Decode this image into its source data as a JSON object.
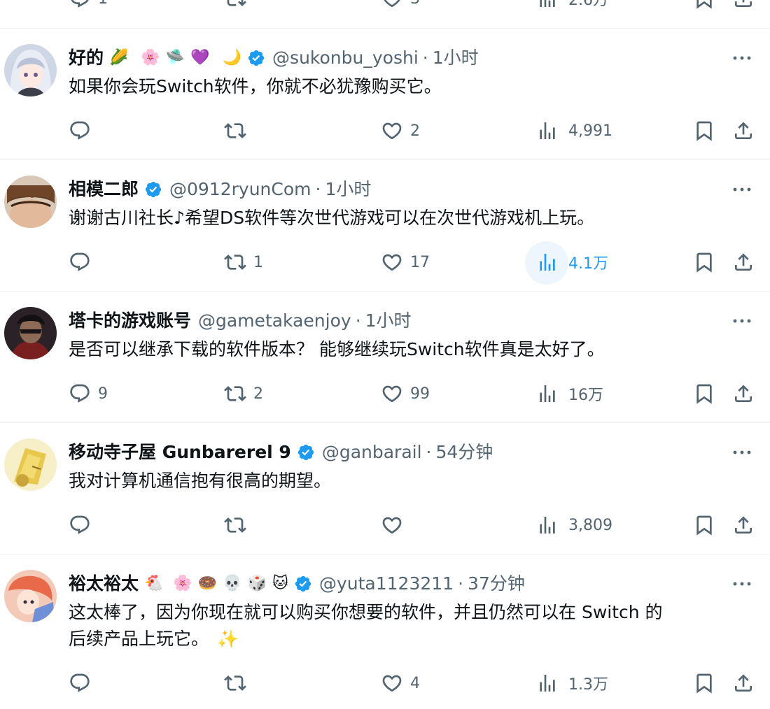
{
  "tweets": [
    {
      "name": "好的",
      "name_emojis": [
        "🌽",
        "🌸",
        "🛸",
        "💜",
        "🌙"
      ],
      "verified": true,
      "handle": "@sukonbu_yoshi",
      "time": "1小时",
      "text": "如果你会玩Switch软件，你就不必犹豫购买它。",
      "replies": "",
      "retweets": "",
      "likes": "2",
      "views": "4,991"
    },
    {
      "name": "相模二郎",
      "name_emojis": [],
      "verified": true,
      "handle": "@0912ryunCom",
      "time": "1小时",
      "text": "谢谢古川社长♪希望DS软件等次世代游戏可以在次世代游戏机上玩。",
      "replies": "",
      "retweets": "1",
      "likes": "17",
      "views": "4.1万"
    },
    {
      "name": "塔卡的游戏账号",
      "name_emojis": [],
      "verified": false,
      "handle": "@gametakaenjoy",
      "time": "1小时",
      "text": "是否可以继承下载的软件版本？ 能够继续玩Switch软件真是太好了。",
      "replies": "9",
      "retweets": "2",
      "likes": "99",
      "views": "16万"
    },
    {
      "name": "移动寺子屋 Gunbarerel 9",
      "name_emojis": [],
      "verified": true,
      "handle": "@ganbarail",
      "time": "54分钟",
      "text": "我对计算机通信抱有很高的期望。",
      "replies": "",
      "retweets": "",
      "likes": "",
      "views": "3,809"
    },
    {
      "name": "裕太裕太",
      "name_emojis": [
        "🐔",
        "🌸",
        "🍩",
        "💀",
        "🎲",
        "🐱"
      ],
      "verified": true,
      "handle": "@yuta1123211",
      "time": "37分钟",
      "text_line1": "这太棒了，因为你现在就可以购买你想要的软件，并且仍然可以在 Switch 的",
      "text_line2": "后续产品上玩它。",
      "text_emoji": "✨",
      "replies": "",
      "retweets": "",
      "likes": "4",
      "views": "1.3万"
    }
  ],
  "colors": {
    "text": "#0f1419",
    "muted": "#536471",
    "verified": "#1d9bf0",
    "divider": "#eff3f4"
  },
  "icons": [
    "reply-icon",
    "retweet-icon",
    "like-icon",
    "views-icon",
    "bookmark-icon",
    "share-icon",
    "more-icon",
    "verified-badge-icon"
  ]
}
